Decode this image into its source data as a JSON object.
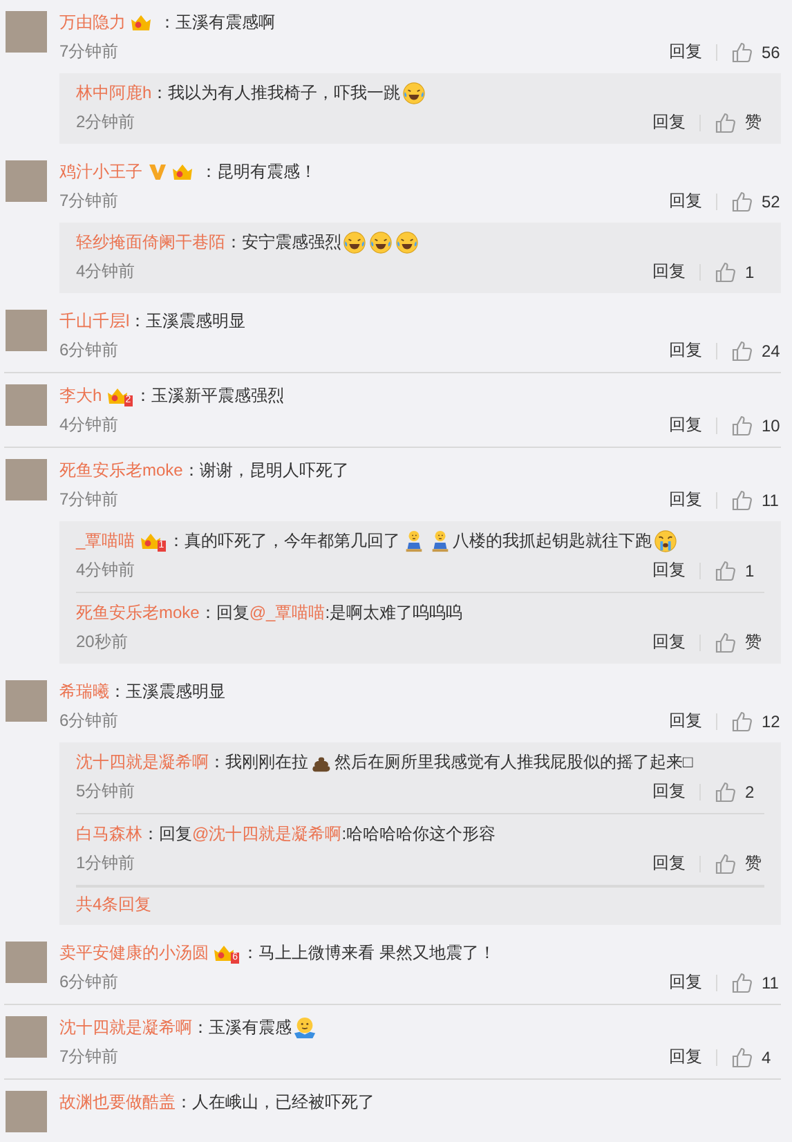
{
  "comments": [
    {
      "name": "万由隐力",
      "badges": [
        {
          "kind": "crown"
        }
      ],
      "content": [
        {
          "kind": "text",
          "text": "：玉溪有震感啊"
        }
      ],
      "time": "7分钟前",
      "reply": "回复",
      "likes": "56",
      "replies": [
        {
          "name": "林中阿鹿h",
          "content": [
            {
              "kind": "text",
              "text": "：我以为有人推我椅子，吓我一跳"
            },
            {
              "kind": "emoji_laugh"
            }
          ],
          "time": "2分钟前",
          "reply": "回复",
          "likes": "赞"
        }
      ]
    },
    {
      "name": "鸡汁小王子",
      "badges": [
        {
          "kind": "vip"
        },
        {
          "kind": "crown"
        }
      ],
      "content": [
        {
          "kind": "text",
          "text": "：昆明有震感！"
        }
      ],
      "time": "7分钟前",
      "reply": "回复",
      "likes": "52",
      "replies": [
        {
          "name": "轻纱掩面倚阑干巷陌",
          "content": [
            {
              "kind": "text",
              "text": "：安宁震感强烈"
            },
            {
              "kind": "emoji_laugh"
            },
            {
              "kind": "emoji_laugh"
            },
            {
              "kind": "emoji_laugh"
            }
          ],
          "time": "4分钟前",
          "reply": "回复",
          "likes": "1"
        }
      ]
    },
    {
      "name": "千山千层l",
      "content": [
        {
          "kind": "text",
          "text": "：玉溪震感明显"
        }
      ],
      "time": "6分钟前",
      "reply": "回复",
      "likes": "24"
    },
    {
      "name": "李大h",
      "badges": [
        {
          "kind": "crown",
          "rank": "2"
        }
      ],
      "content": [
        {
          "kind": "text",
          "text": "：玉溪新平震感强烈"
        }
      ],
      "time": "4分钟前",
      "reply": "回复",
      "likes": "10"
    },
    {
      "name": "死鱼安乐老moke",
      "content": [
        {
          "kind": "text",
          "text": "：谢谢，昆明人吓死了"
        }
      ],
      "time": "7分钟前",
      "reply": "回复",
      "likes": "11",
      "replies": [
        {
          "name": "_覃喵喵",
          "badges": [
            {
              "kind": "crown",
              "rank": "1"
            }
          ],
          "content": [
            {
              "kind": "text",
              "text": "：真的吓死了，今年都第几回了"
            },
            {
              "kind": "emoji_sweat"
            },
            {
              "kind": "emoji_sweat"
            },
            {
              "kind": "text",
              "text": "八楼的我抓起钥匙就往下跑"
            },
            {
              "kind": "emoji_cry"
            }
          ],
          "time": "4分钟前",
          "reply": "回复",
          "likes": "1"
        },
        {
          "name": "死鱼安乐老moke",
          "content": [
            {
              "kind": "text",
              "text": "：回复"
            },
            {
              "kind": "mention",
              "text": "@_覃喵喵"
            },
            {
              "kind": "text",
              "text": ":是啊太难了呜呜呜"
            }
          ],
          "time": "20秒前",
          "reply": "回复",
          "likes": "赞"
        }
      ]
    },
    {
      "name": "希瑞曦",
      "content": [
        {
          "kind": "text",
          "text": "：玉溪震感明显"
        }
      ],
      "time": "6分钟前",
      "reply": "回复",
      "likes": "12",
      "replies": [
        {
          "name": "沈十四就是凝希啊",
          "content": [
            {
              "kind": "text",
              "text": "：我刚刚在拉"
            },
            {
              "kind": "emoji_poop"
            },
            {
              "kind": "text",
              "text": "然后在厕所里我感觉有人推我屁股似的摇了起来□"
            }
          ],
          "time": "5分钟前",
          "reply": "回复",
          "likes": "2"
        },
        {
          "name": "白马森林",
          "content": [
            {
              "kind": "text",
              "text": "：回复"
            },
            {
              "kind": "mention",
              "text": "@沈十四就是凝希啊"
            },
            {
              "kind": "text",
              "text": ":哈哈哈哈你这个形容"
            }
          ],
          "time": "1分钟前",
          "reply": "回复",
          "likes": "赞"
        }
      ],
      "more": "共4条回复"
    },
    {
      "name": "卖平安健康的小汤圆",
      "badges": [
        {
          "kind": "crown",
          "rank": "6"
        }
      ],
      "content": [
        {
          "kind": "text",
          "text": "：马上上微博来看 果然又地震了！"
        }
      ],
      "time": "6分钟前",
      "reply": "回复",
      "likes": "11"
    },
    {
      "name": "沈十四就是凝希啊",
      "content": [
        {
          "kind": "text",
          "text": "：玉溪有震感"
        },
        {
          "kind": "emoji_shrug"
        }
      ],
      "time": "7分钟前",
      "reply": "回复",
      "likes": "4"
    },
    {
      "name": "故渊也要做酷盖",
      "content": [
        {
          "kind": "text",
          "text": "：人在峨山，已经被吓死了"
        }
      ]
    }
  ]
}
